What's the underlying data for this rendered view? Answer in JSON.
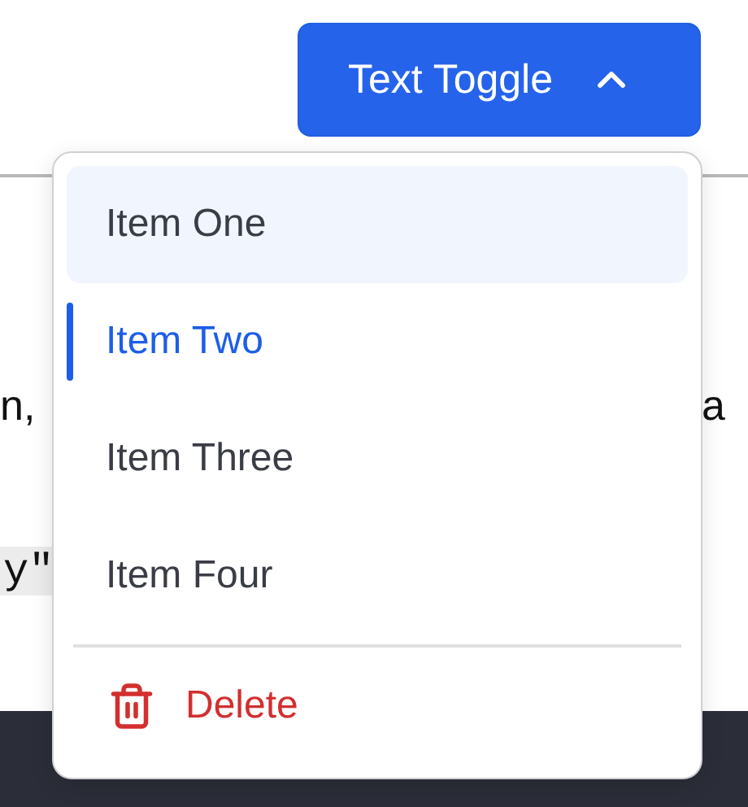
{
  "toggle_button": {
    "label": "Text Toggle",
    "expanded": true
  },
  "background": {
    "text_left": "n,",
    "text_right": "a",
    "code": "y\""
  },
  "menu": {
    "items": [
      {
        "label": "Item One",
        "selected": false,
        "hovered": true
      },
      {
        "label": "Item Two",
        "selected": true,
        "hovered": false
      },
      {
        "label": "Item Three",
        "selected": false,
        "hovered": false
      },
      {
        "label": "Item Four",
        "selected": false,
        "hovered": false
      }
    ],
    "delete": {
      "label": "Delete"
    }
  }
}
